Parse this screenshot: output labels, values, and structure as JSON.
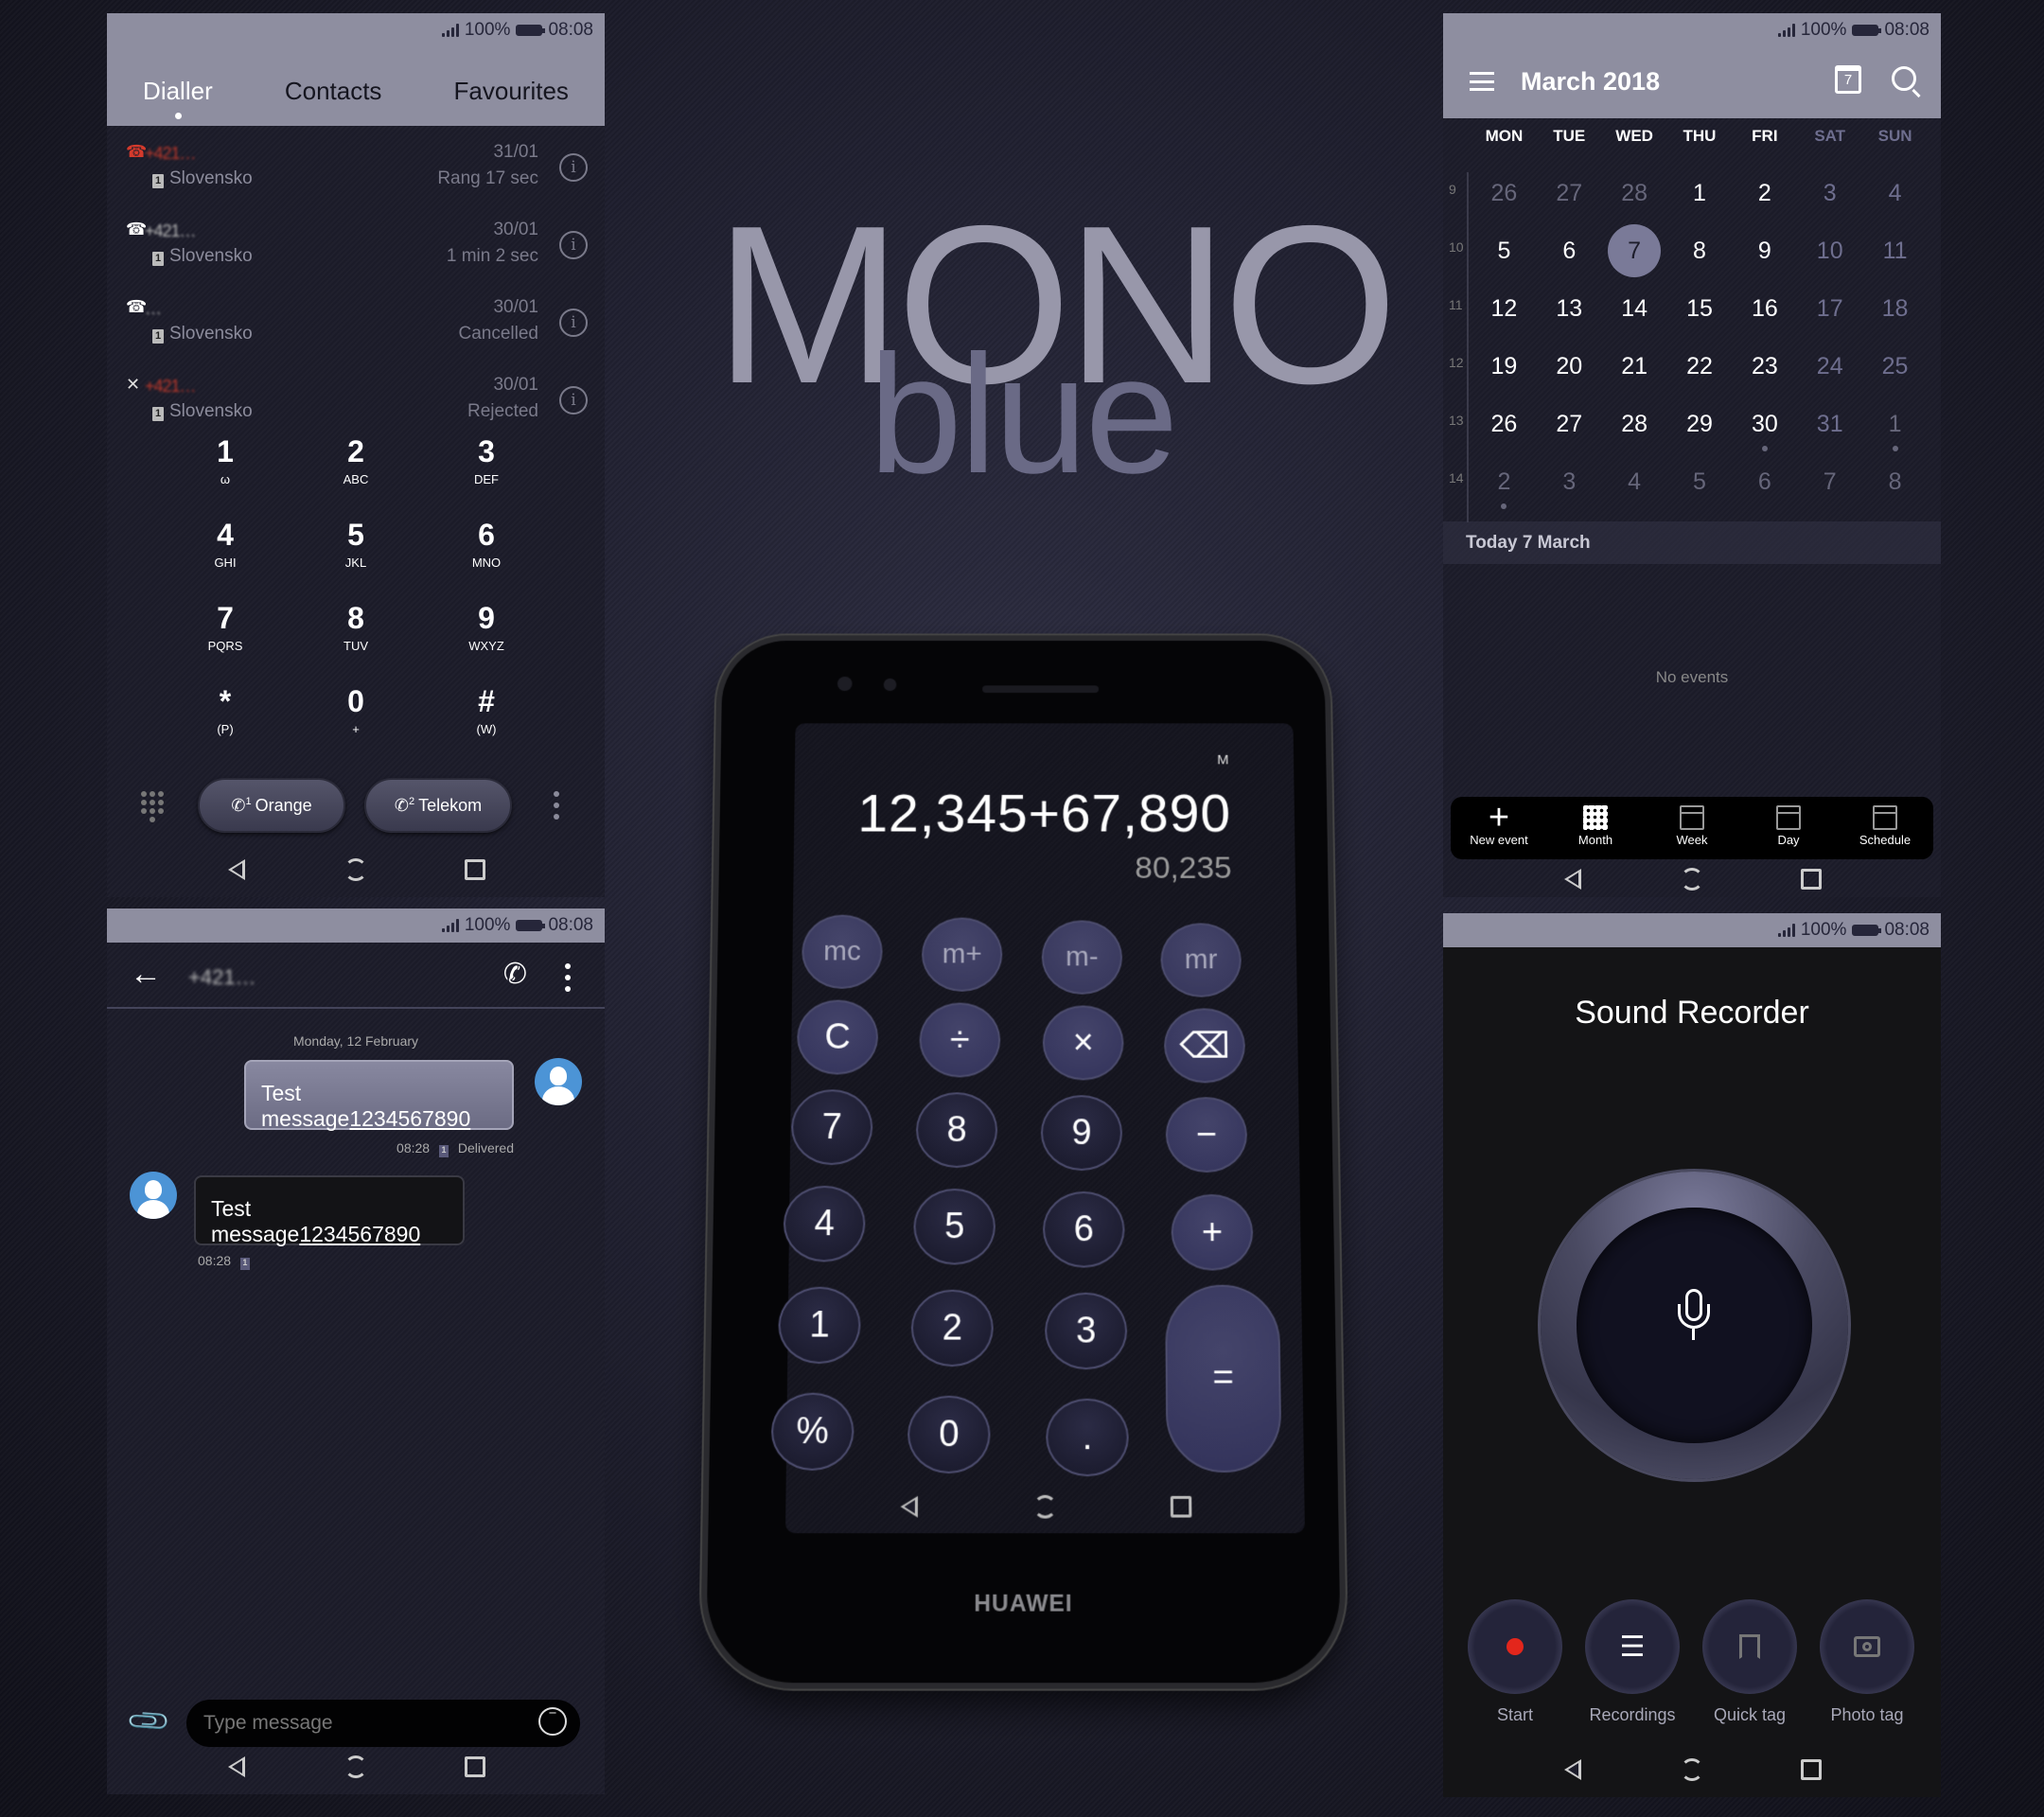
{
  "status_bar": {
    "battery": "100%",
    "time": "08:08"
  },
  "title": {
    "main": "MONO",
    "sub": "blue"
  },
  "dialler": {
    "tabs": [
      {
        "label": "Dialler",
        "active": true
      },
      {
        "label": "Contacts",
        "active": false
      },
      {
        "label": "Favourites",
        "active": false
      }
    ],
    "calls": [
      {
        "type": "missed",
        "name": "+421…",
        "sim": "Slovensko",
        "date": "31/01",
        "detail": "Rang 17 sec"
      },
      {
        "type": "incoming",
        "name": "+421…",
        "sim": "Slovensko",
        "date": "30/01",
        "detail": "1 min 2 sec"
      },
      {
        "type": "outgoing",
        "name": "…",
        "sim": "Slovensko",
        "date": "30/01",
        "detail": "Cancelled"
      },
      {
        "type": "rejected",
        "name": "+421…",
        "sim": "Slovensko",
        "date": "30/01",
        "detail": "Rejected"
      }
    ],
    "keys": [
      {
        "digit": "1",
        "letters": "ω"
      },
      {
        "digit": "2",
        "letters": "ABC"
      },
      {
        "digit": "3",
        "letters": "DEF"
      },
      {
        "digit": "4",
        "letters": "GHI"
      },
      {
        "digit": "5",
        "letters": "JKL"
      },
      {
        "digit": "6",
        "letters": "MNO"
      },
      {
        "digit": "7",
        "letters": "PQRS"
      },
      {
        "digit": "8",
        "letters": "TUV"
      },
      {
        "digit": "9",
        "letters": "WXYZ"
      },
      {
        "digit": "*",
        "letters": "(P)"
      },
      {
        "digit": "0",
        "letters": "+"
      },
      {
        "digit": "#",
        "letters": "(W)"
      }
    ],
    "sim_buttons": [
      {
        "sim": "1",
        "label": "Orange"
      },
      {
        "sim": "2",
        "label": "Telekom"
      }
    ]
  },
  "messages": {
    "contact": "+421…",
    "date_header": "Monday, 12 February",
    "sent": {
      "text": "Test message",
      "link": "1234567890",
      "time": "08:28",
      "sim": "1",
      "status": "Delivered"
    },
    "received": {
      "text": "Test message",
      "link": "1234567890",
      "time": "08:28",
      "sim": "1"
    },
    "input_placeholder": "Type message"
  },
  "calculator": {
    "memory_indicator": "M",
    "expression": "12,345+67,890",
    "result": "80,235",
    "memory_keys": [
      "mc",
      "m+",
      "m-",
      "mr"
    ],
    "op_row": [
      "C",
      "÷",
      "×",
      "⌫"
    ],
    "rows": [
      [
        "7",
        "8",
        "9",
        "−"
      ],
      [
        "4",
        "5",
        "6",
        "+"
      ],
      [
        "1",
        "2",
        "3"
      ],
      [
        "%",
        "0",
        "."
      ]
    ],
    "equals": "=",
    "brand": "HUAWEI"
  },
  "calendar": {
    "month_title": "March 2018",
    "calendar_icon_day": "7",
    "weekdays": [
      "MON",
      "TUE",
      "WED",
      "THU",
      "FRI",
      "SAT",
      "SUN"
    ],
    "weeks": [
      {
        "num": "9",
        "days": [
          {
            "d": "26",
            "s": "dim"
          },
          {
            "d": "27",
            "s": "dim"
          },
          {
            "d": "28",
            "s": "dim"
          },
          {
            "d": "1"
          },
          {
            "d": "2"
          },
          {
            "d": "3",
            "s": "wkend"
          },
          {
            "d": "4",
            "s": "wkend"
          }
        ]
      },
      {
        "num": "10",
        "days": [
          {
            "d": "5"
          },
          {
            "d": "6"
          },
          {
            "d": "7",
            "s": "today"
          },
          {
            "d": "8"
          },
          {
            "d": "9"
          },
          {
            "d": "10",
            "s": "wkend"
          },
          {
            "d": "11",
            "s": "wkend"
          }
        ]
      },
      {
        "num": "11",
        "days": [
          {
            "d": "12"
          },
          {
            "d": "13"
          },
          {
            "d": "14"
          },
          {
            "d": "15"
          },
          {
            "d": "16"
          },
          {
            "d": "17",
            "s": "wkend"
          },
          {
            "d": "18",
            "s": "wkend"
          }
        ]
      },
      {
        "num": "12",
        "days": [
          {
            "d": "19"
          },
          {
            "d": "20"
          },
          {
            "d": "21"
          },
          {
            "d": "22"
          },
          {
            "d": "23"
          },
          {
            "d": "24",
            "s": "wkend"
          },
          {
            "d": "25",
            "s": "wkend"
          }
        ]
      },
      {
        "num": "13",
        "days": [
          {
            "d": "26"
          },
          {
            "d": "27"
          },
          {
            "d": "28"
          },
          {
            "d": "29"
          },
          {
            "d": "30",
            "dot": true
          },
          {
            "d": "31",
            "s": "wkend"
          },
          {
            "d": "1",
            "s": "dim",
            "dot": true
          }
        ]
      },
      {
        "num": "14",
        "days": [
          {
            "d": "2",
            "s": "dim",
            "dot": true
          },
          {
            "d": "3",
            "s": "dim"
          },
          {
            "d": "4",
            "s": "dim"
          },
          {
            "d": "5",
            "s": "dim"
          },
          {
            "d": "6",
            "s": "dim"
          },
          {
            "d": "7",
            "s": "dim"
          },
          {
            "d": "8",
            "s": "dim"
          }
        ]
      }
    ],
    "today_label": "Today  7 March",
    "empty_text": "No events",
    "bottom_nav": [
      {
        "label": "New event",
        "icon": "plus-icon",
        "active": false
      },
      {
        "label": "Month",
        "icon": "month-icon",
        "active": true
      },
      {
        "label": "Week",
        "icon": "week-icon",
        "active": false
      },
      {
        "label": "Day",
        "icon": "day-icon",
        "active": false
      },
      {
        "label": "Schedule",
        "icon": "schedule-icon",
        "active": false
      }
    ]
  },
  "recorder": {
    "title": "Sound Recorder",
    "actions": [
      {
        "label": "Start",
        "icon": "record-icon"
      },
      {
        "label": "Recordings",
        "icon": "list-icon"
      },
      {
        "label": "Quick tag",
        "icon": "bookmark-icon"
      },
      {
        "label": "Photo tag",
        "icon": "camera-icon"
      }
    ],
    "record_color": "#e3261c"
  }
}
